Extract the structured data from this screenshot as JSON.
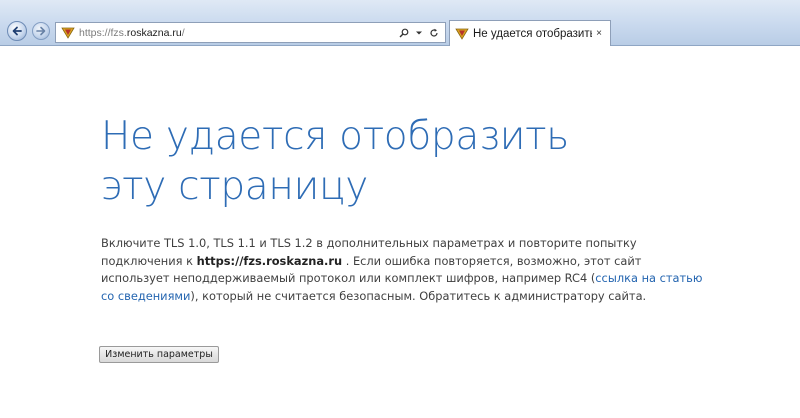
{
  "browser": {
    "address_bar": {
      "url_prefix": "https://fzs.",
      "url_domain": "roskazna.ru",
      "url_suffix": "/"
    },
    "tab": {
      "title": "Не удается отобразить эту ...",
      "close_glyph": "×"
    },
    "icons": {
      "back": "back-arrow-icon",
      "forward": "forward-arrow-icon",
      "site": "government-emblem-icon",
      "search": "search-icon",
      "dropdown": "chevron-down-icon",
      "refresh": "refresh-icon"
    }
  },
  "page": {
    "title": "Не удается отобразить эту страницу",
    "message": {
      "part1": "Включите TLS 1.0, TLS 1.1 и TLS 1.2 в дополнительных параметрах и повторите попытку подключения к ",
      "host": "https://fzs.roskazna.ru",
      "part2": " . Если ошибка повторяется, возможно, этот сайт использует неподдерживаемый протокол или комплект шифров, например RC4 (",
      "link": "ссылка на статью со сведениями",
      "part3": "), который не считается безопасным. Обратитесь к администратору сайта."
    },
    "button_label": "Изменить параметры"
  },
  "colors": {
    "title": "#2e6cb5",
    "link": "#2465b0",
    "body_text": "#404040",
    "chrome": "#c9d9ee"
  }
}
